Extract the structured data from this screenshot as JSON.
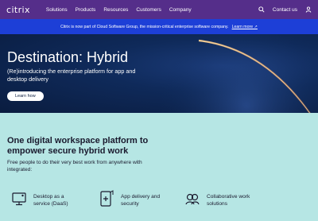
{
  "nav": {
    "logo": "citrix",
    "links": [
      "Solutions",
      "Products",
      "Resources",
      "Customers",
      "Company"
    ],
    "contact": "Contact us",
    "search_icon": "search-icon",
    "user_icon": "user-icon"
  },
  "banner": {
    "text": "Citrix is now part of Cloud Software Group, the mission-critical enterprise software company.",
    "link": "Learn more ↗"
  },
  "hero": {
    "title": "Destination: Hybrid",
    "subtitle": "(Re)introducing the enterprise platform for app and desktop delivery",
    "button": "Learn how"
  },
  "main": {
    "title": "One digital workspace platform to empower secure hybrid work",
    "description": "Free people to do their very best work from anywhere with integrated:",
    "features": [
      {
        "icon": "desktop-icon",
        "label": "Desktop as a service (DaaS)"
      },
      {
        "icon": "app-delivery-icon",
        "label": "App delivery and security"
      },
      {
        "icon": "collaboration-icon",
        "label": "Collaborative work solutions"
      }
    ]
  },
  "colors": {
    "nav_bg": "#552e8a",
    "banner_bg": "#1d3fd7",
    "hero_bg": "#0f2a5a",
    "main_bg": "#b6e6e4"
  }
}
